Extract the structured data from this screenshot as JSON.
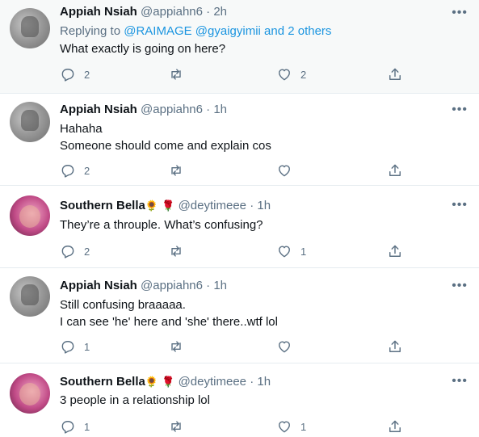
{
  "tweets": [
    {
      "name": "Appiah Nsiah",
      "handle": "@appiahn6",
      "sep": "·",
      "time": "2h",
      "replying_prefix": "Replying to",
      "replying_mentions": "@RAIMAGE @gyaigyimii and 2 others",
      "lines": [
        "What exactly is going on here?"
      ],
      "reply_count": "2",
      "retweet_count": "",
      "like_count": "2",
      "avatar": "appiah"
    },
    {
      "name": "Appiah Nsiah",
      "handle": "@appiahn6",
      "sep": "·",
      "time": "1h",
      "lines": [
        "Hahaha",
        "Someone should come and explain cos"
      ],
      "reply_count": "2",
      "retweet_count": "",
      "like_count": "",
      "avatar": "appiah"
    },
    {
      "name": "Southern Bella",
      "emojis": [
        "🌻",
        "🌹"
      ],
      "handle": "@deytimeee",
      "sep": "·",
      "time": "1h",
      "lines": [
        "They’re a throuple. What’s confusing?"
      ],
      "reply_count": "2",
      "retweet_count": "",
      "like_count": "1",
      "avatar": "bella"
    },
    {
      "name": "Appiah Nsiah",
      "handle": "@appiahn6",
      "sep": "·",
      "time": "1h",
      "lines": [
        "Still confusing braaaaa.",
        "I can see 'he' here and 'she' there..wtf lol"
      ],
      "reply_count": "1",
      "retweet_count": "",
      "like_count": "",
      "avatar": "appiah"
    },
    {
      "name": "Southern Bella",
      "emojis": [
        "🌻",
        "🌹"
      ],
      "handle": "@deytimeee",
      "sep": "·",
      "time": "1h",
      "lines": [
        "3 people in a relationship lol"
      ],
      "reply_count": "1",
      "retweet_count": "",
      "like_count": "1",
      "avatar": "bella"
    }
  ],
  "icons": {
    "more": "more-horizontal-icon",
    "reply": "reply-icon",
    "retweet": "retweet-icon",
    "like": "heart-icon",
    "share": "share-icon"
  },
  "colors": {
    "link": "#1b95e0",
    "secondary": "#5b7083",
    "highlight_bg": "#f7f9f9"
  }
}
